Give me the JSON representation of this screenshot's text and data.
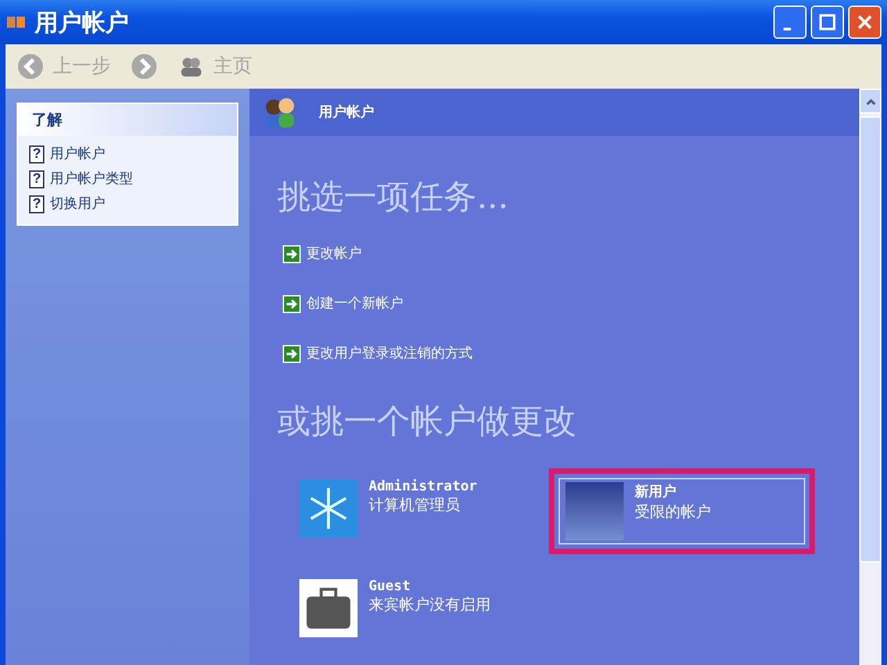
{
  "window": {
    "title": "用户帐户"
  },
  "toolbar": {
    "back": {
      "label": "上一步",
      "disabled": true
    },
    "forward": {
      "disabled": true
    },
    "home": {
      "label": "主页",
      "disabled": true
    }
  },
  "sidebar": {
    "title": "了解",
    "items": [
      {
        "icon": "?",
        "label": "用户帐户"
      },
      {
        "icon": "?",
        "label": "用户帐户类型"
      },
      {
        "icon": "?",
        "label": "切换用户"
      }
    ]
  },
  "header": {
    "title": "用户帐户"
  },
  "task_heading": "挑选一项任务...",
  "tasks": [
    {
      "label": "更改帐户"
    },
    {
      "label": "创建一个新帐户"
    },
    {
      "label": "更改用户登录或注销的方式"
    }
  ],
  "account_heading": "或挑一个帐户做更改",
  "accounts": [
    {
      "name": "Administrator",
      "type": "计算机管理员",
      "kind": "snowflake",
      "highlighted": false
    },
    {
      "name": "新用户",
      "type": "受限的帐户",
      "kind": "photo",
      "highlighted": true
    },
    {
      "name": "Guest",
      "type": "来宾帐户没有启用",
      "kind": "suitcase",
      "highlighted": false
    }
  ]
}
